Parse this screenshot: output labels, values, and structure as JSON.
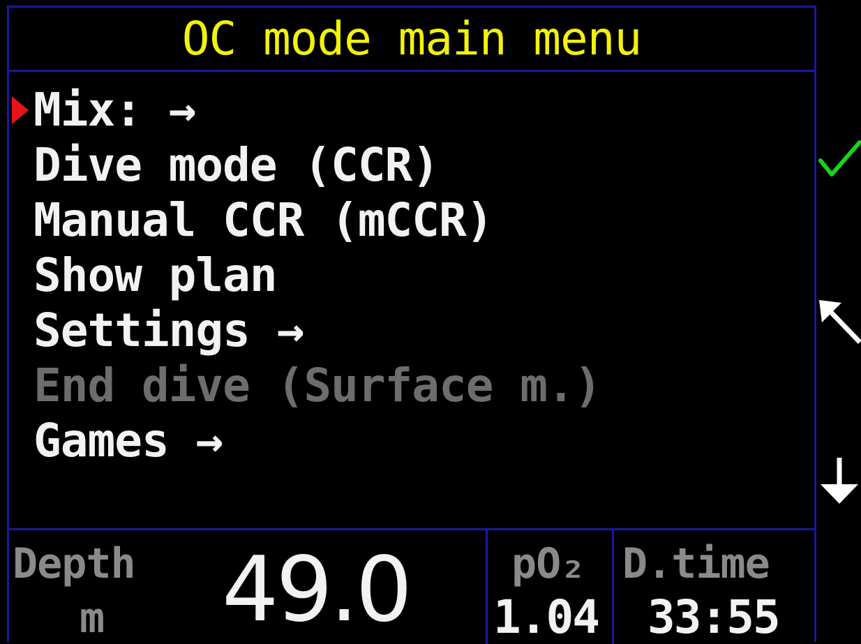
{
  "header": {
    "title": "OC mode main menu"
  },
  "menu": {
    "selected_index": 0,
    "items": [
      {
        "label": "Mix: →",
        "enabled": true
      },
      {
        "label": "Dive mode (CCR)",
        "enabled": true
      },
      {
        "label": "Manual CCR (mCCR)",
        "enabled": true
      },
      {
        "label": "Show plan",
        "enabled": true
      },
      {
        "label": "Settings →",
        "enabled": true
      },
      {
        "label": "End dive (Surface m.)",
        "enabled": false
      },
      {
        "label": "Games →",
        "enabled": true
      }
    ]
  },
  "side_buttons": [
    {
      "icon": "checkmark-icon",
      "color": "#19d31c"
    },
    {
      "icon": "arrow-up-left-icon",
      "color": "#ffffff"
    },
    {
      "icon": "arrow-down-icon",
      "color": "#ffffff"
    }
  ],
  "status": {
    "depth_label": "Depth",
    "depth_unit": "m",
    "depth_value": "49.0",
    "po2_label": "pO₂",
    "po2_value": "1.04",
    "dtime_label": "D.time",
    "dtime_value": "33:55"
  },
  "colors": {
    "title": "#f2f20a",
    "frame": "#1a1a9e",
    "cursor": "#e8131a",
    "text": "#f2f2f2",
    "disabled_text": "#6d6d6d",
    "label_text": "#8a8a8a"
  }
}
